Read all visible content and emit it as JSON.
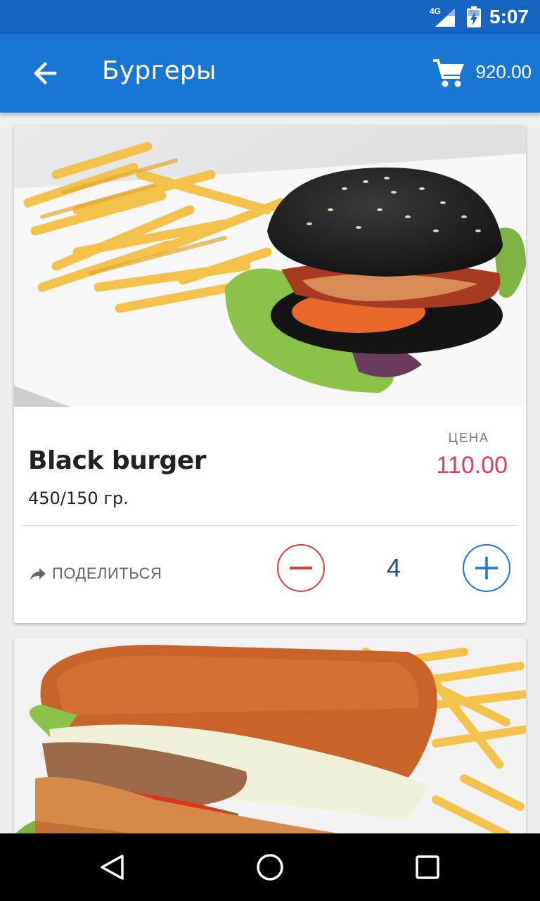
{
  "status_bar": {
    "time": "5:07",
    "network": "4G",
    "icons": [
      "signal-icon",
      "battery-icon"
    ]
  },
  "app_bar": {
    "back_icon": "arrow-left-icon",
    "title": "Бургеры",
    "cart_icon": "cart-icon",
    "cart_total": "920.00"
  },
  "products": [
    {
      "image": "black-burger-photo",
      "name": "Black burger",
      "weight": "450/150 гр.",
      "price_label": "ЦЕНА",
      "price": "110.00",
      "share_label": "ПОДЕЛИТЬСЯ",
      "quantity": "4",
      "minus_icon": "minus-icon",
      "plus_icon": "plus-icon"
    },
    {
      "image": "sandwich-photo"
    }
  ],
  "colors": {
    "status_bar": "#1565c0",
    "app_bar": "#1976d2",
    "price": "#e9395d",
    "minus": "#e03a3a",
    "plus": "#1976d2",
    "quantity": "#1f4e8c"
  },
  "nav_bar": {
    "icons": [
      "back-triangle-icon",
      "home-circle-icon",
      "recents-square-icon"
    ]
  }
}
